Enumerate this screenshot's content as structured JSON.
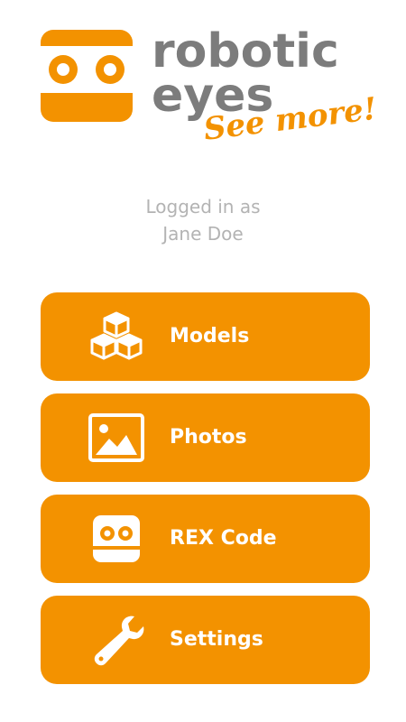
{
  "brand": {
    "line1": "robotic",
    "line2": "eyes",
    "tagline": "See more!",
    "logo_icon": "robotic-eyes-logo-icon",
    "accent_color": "#f39200",
    "text_color": "#7c7c7c"
  },
  "login": {
    "label": "Logged in as",
    "user": "Jane Doe"
  },
  "menu": {
    "items": [
      {
        "label": "Models",
        "icon": "cubes-icon"
      },
      {
        "label": "Photos",
        "icon": "image-icon"
      },
      {
        "label": "REX Code",
        "icon": "rex-code-icon"
      },
      {
        "label": "Settings",
        "icon": "wrench-icon"
      }
    ]
  }
}
